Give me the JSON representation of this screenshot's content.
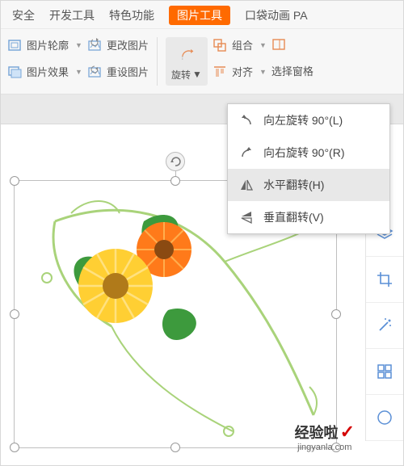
{
  "tabs": {
    "security": "安全",
    "devtools": "开发工具",
    "special": "特色功能",
    "picture_tools": "图片工具",
    "pocket_anim": "口袋动画 PA"
  },
  "ribbon": {
    "pic_outline": "图片轮廓",
    "pic_effects": "图片效果",
    "change_pic": "更改图片",
    "reset_pic": "重设图片",
    "rotate": "旋转",
    "group": "组合",
    "align": "对齐",
    "sel_pane": "选择窗格"
  },
  "menu": {
    "rotate_left": "向左旋转 90°(L)",
    "rotate_right": "向右旋转 90°(R)",
    "flip_h": "水平翻转(H)",
    "flip_v": "垂直翻转(V)"
  },
  "side": {
    "layers": "layers",
    "crop": "crop",
    "magic": "magic",
    "layout": "layout"
  },
  "watermark": {
    "line1": "经验啦",
    "line2": "jingyanla.com"
  }
}
